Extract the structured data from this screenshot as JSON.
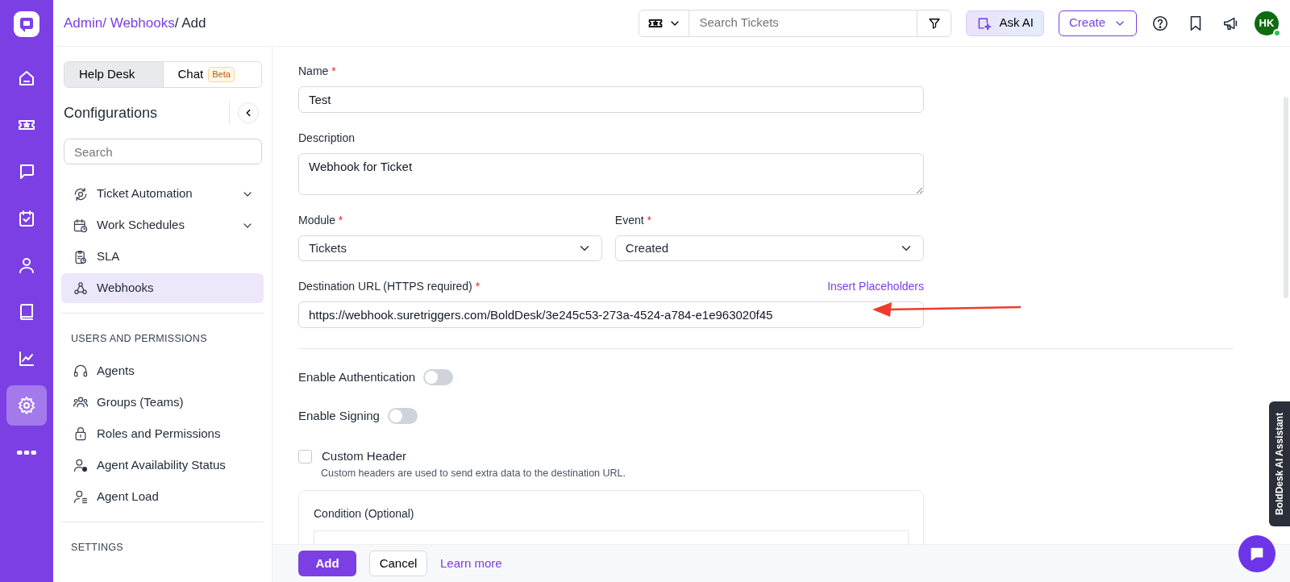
{
  "rail": {
    "items": [
      {
        "selected": false
      },
      {
        "selected": false
      },
      {
        "selected": false
      },
      {
        "selected": false
      },
      {
        "selected": false
      },
      {
        "selected": false
      },
      {
        "selected": false
      },
      {
        "selected": true
      },
      {
        "selected": false
      }
    ]
  },
  "breadcrumb": [
    {
      "label": "Admin/ ",
      "link": true
    },
    {
      "label": "Webhooks",
      "link": true
    },
    {
      "label": "/ Add",
      "link": false
    }
  ],
  "header": {
    "search_placeholder": "Search Tickets",
    "ask_ai": "Ask AI",
    "create": "Create",
    "avatar": "HK",
    "online": true
  },
  "sidebar": {
    "tabs": [
      {
        "label": "Help Desk",
        "selected": true
      },
      {
        "label": "Chat",
        "badge": "Beta",
        "selected": false
      }
    ],
    "title": "Configurations",
    "search_placeholder": "Search",
    "sections": [
      {
        "items": [
          {
            "label": "Ticket Automation",
            "expandable": true,
            "selected": false
          },
          {
            "label": "Work Schedules",
            "expandable": true,
            "selected": false
          },
          {
            "label": "SLA",
            "expandable": false,
            "selected": false
          },
          {
            "label": "Webhooks",
            "expandable": false,
            "selected": true
          }
        ]
      },
      {
        "heading": "USERS AND PERMISSIONS",
        "items": [
          {
            "label": "Agents",
            "expandable": false,
            "selected": false
          },
          {
            "label": "Groups (Teams)",
            "expandable": false,
            "selected": false
          },
          {
            "label": "Roles and Permissions",
            "expandable": false,
            "selected": false
          },
          {
            "label": "Agent Availability Status",
            "expandable": false,
            "selected": false
          },
          {
            "label": "Agent Load",
            "expandable": false,
            "selected": false
          }
        ]
      },
      {
        "heading": "SETTINGS"
      }
    ]
  },
  "form": {
    "name": {
      "label": "Name",
      "required_mark": "*",
      "value": "Test"
    },
    "description": {
      "label": "Description",
      "value": "Webhook for Ticket"
    },
    "module": {
      "label": "Module",
      "required_mark": "*",
      "value": "Tickets"
    },
    "event": {
      "label": "Event",
      "required_mark": "*",
      "value": "Created"
    },
    "destination": {
      "label": "Destination URL (HTTPS required)",
      "required_mark": "*",
      "link": "Insert Placeholders",
      "value": "https://webhook.suretriggers.com/BoldDesk/3e245c53-273a-4524-a784-e1e963020f45"
    },
    "toggles": [
      {
        "label": "Enable Authentication",
        "on": false
      },
      {
        "label": "Enable Signing",
        "on": false
      }
    ],
    "custom_header": {
      "label": "Custom Header",
      "checked": false,
      "hint": "Custom headers are used to send extra data to the destination URL."
    },
    "condition": {
      "title": "Condition (Optional)"
    }
  },
  "footer": {
    "add": "Add",
    "cancel": "Cancel",
    "learn_more": "Learn more"
  },
  "assistant_tab": "BoldDesk AI Assistant"
}
